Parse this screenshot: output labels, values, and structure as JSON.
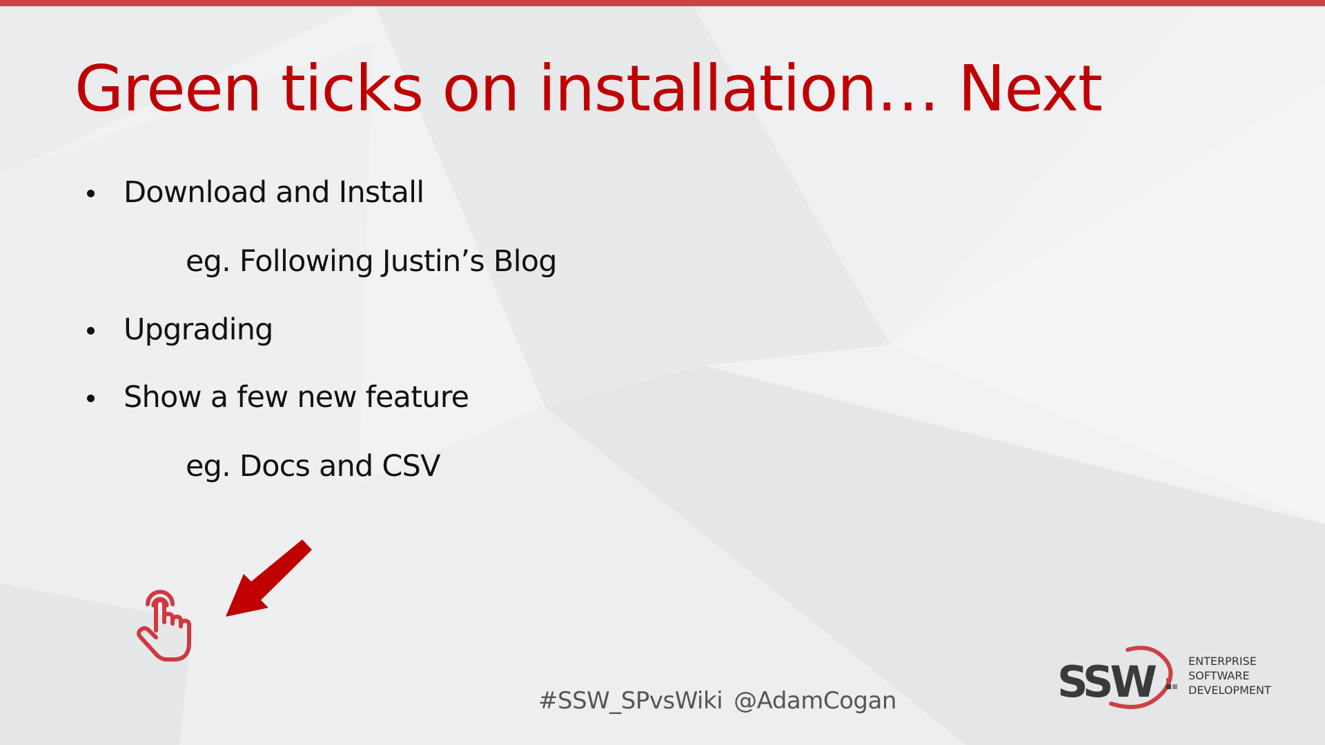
{
  "slide": {
    "title": "Green ticks on installation… Next",
    "footer_hashtag": "#SSW_SPvsWiki",
    "footer_handle": "@AdamCogan",
    "bullets": [
      {
        "level": 1,
        "text": "Download and Install"
      },
      {
        "level": 2,
        "text": "eg. Following Justin’s Blog"
      },
      {
        "level": 1,
        "text": "Upgrading"
      },
      {
        "level": 1,
        "text": "Show a few new feature"
      },
      {
        "level": 2,
        "text": "eg. Docs and CSV"
      }
    ]
  },
  "logo": {
    "mark": "SSW",
    "tagline": [
      "ENTERPRISE",
      "SOFTWARE",
      "DEVELOPMENT"
    ]
  },
  "icons": {
    "hand": "pointing-hand-icon",
    "arrow": "arrow-down-left-icon"
  },
  "colors": {
    "accent": "#c00000",
    "top_bar": "#cc4146",
    "text": "#111111",
    "footer_text": "#555555",
    "logo_text": "#3a3a3a",
    "icon_red": "#d1383f"
  }
}
